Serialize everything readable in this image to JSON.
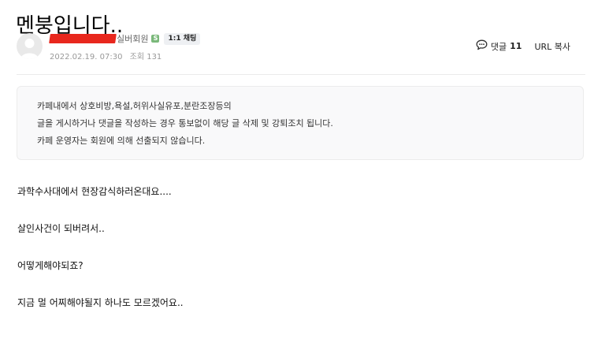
{
  "post": {
    "title": "멘붕입니다..",
    "author": {
      "nickname_redacted": true,
      "grade": "실버회원",
      "grade_badge": "S",
      "chat_button": "1:1 채팅"
    },
    "date": "2022.02.19. 07:30",
    "views_label": "조회 131",
    "comments_label": "댓글",
    "comments_count": "11",
    "url_copy_label": "URL 복사",
    "notice_lines": [
      "카페내에서 상호비방,욕설,허위사실유포,분란조장등의",
      "글을 게시하거나 댓글을 작성하는 경우 통보없이 해당 글 삭제 및 강퇴조치 됩니다.",
      "카페 운영자는 회원에 의해 선출되지 않습니다."
    ],
    "body_lines": [
      "과학수사대에서 현장감식하러온대요....",
      "살인사건이 되버려서..",
      "어떻게해야되죠?",
      "지금 멀 어찌해야될지 하나도 모르겠어요.."
    ]
  },
  "colors": {
    "redaction": "#e8271d",
    "badge": "#7ab87a",
    "notice_bg": "#f9f9fa"
  },
  "icons": [
    "avatar-default-icon",
    "comment-bubble-icon"
  ]
}
